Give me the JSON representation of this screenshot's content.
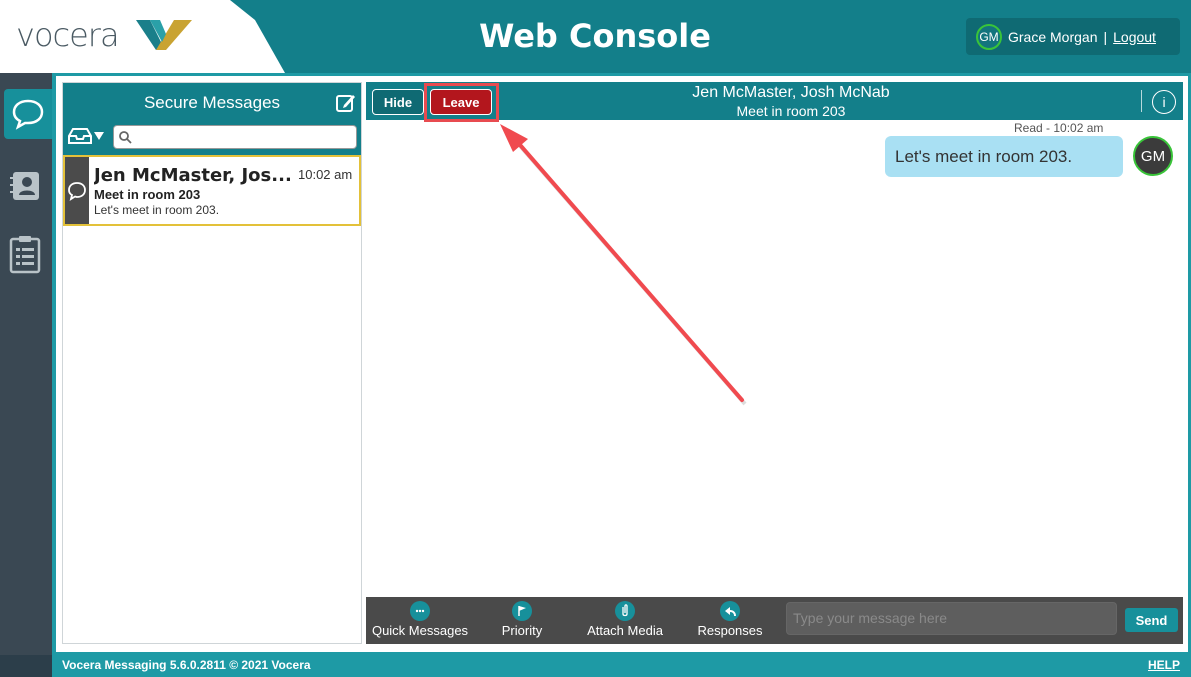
{
  "header": {
    "logo_text": "vocera",
    "title": "Web Console",
    "user_initials": "GM",
    "user_name": "Grace Morgan",
    "separator": "|",
    "logout_label": "Logout"
  },
  "rail": {
    "items": [
      {
        "icon": "messages-icon",
        "active": true
      },
      {
        "icon": "contacts-icon",
        "active": false
      },
      {
        "icon": "clipboard-icon",
        "active": false
      }
    ]
  },
  "list": {
    "title": "Secure Messages",
    "search_placeholder": "",
    "items": [
      {
        "name": "Jen McMaster, Jos...",
        "time": "10:02 am",
        "subject": "Meet in room 203",
        "preview": "Let's meet in room 203."
      }
    ]
  },
  "conversation": {
    "hide_label": "Hide",
    "leave_label": "Leave",
    "title": "Jen McMaster, Josh McNab",
    "subtitle": "Meet in room 203",
    "info_label": "i",
    "messages": [
      {
        "status": "Read - 10:02 am",
        "text": "Let's meet in room 203.",
        "sender_initials": "GM"
      }
    ]
  },
  "toolbar": {
    "quick_messages": "Quick Messages",
    "priority": "Priority",
    "attach_media": "Attach Media",
    "responses": "Responses",
    "input_placeholder": "Type your message here",
    "send_label": "Send"
  },
  "footer": {
    "copyright": "Vocera Messaging 5.6.0.2811 © 2021 Vocera",
    "help_label": "HELP"
  },
  "colors": {
    "teal_dark": "#137f8a",
    "teal": "#1e9aa5",
    "leave_red": "#b3161d",
    "highlight_red": "#e84b50",
    "bubble_blue": "#a9e0f3",
    "presence_green": "#39c439"
  }
}
